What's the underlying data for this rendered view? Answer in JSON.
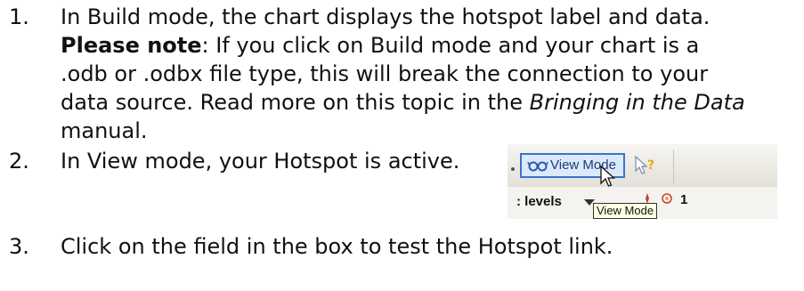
{
  "items": [
    {
      "number": "1.",
      "line1": "In Build mode, the chart displays the hotspot label and data.",
      "note_bold": "Please note",
      "note_rest": ":  If you click on Build mode and your chart is a",
      "line3": ".odb or .odbx file type, this will break the connection to your",
      "line4_start": "data source.  Read more on this topic in the ",
      "line4_italic": "Bringing in the Data",
      "line5": "manual."
    },
    {
      "number": "2.",
      "text": "In View mode, your Hotspot is active."
    },
    {
      "number": "3.",
      "text": "Click on the field in the box to test the Hotspot link."
    }
  ],
  "screenshot": {
    "view_mode_label": "View Mode",
    "levels_label": ": levels",
    "tooltip": "View Mode",
    "partial_number": "1",
    "icons": {
      "view_mode": "view-mode-glasses-icon",
      "help": "help-icon",
      "cursor": "mouse-pointer-icon"
    }
  }
}
